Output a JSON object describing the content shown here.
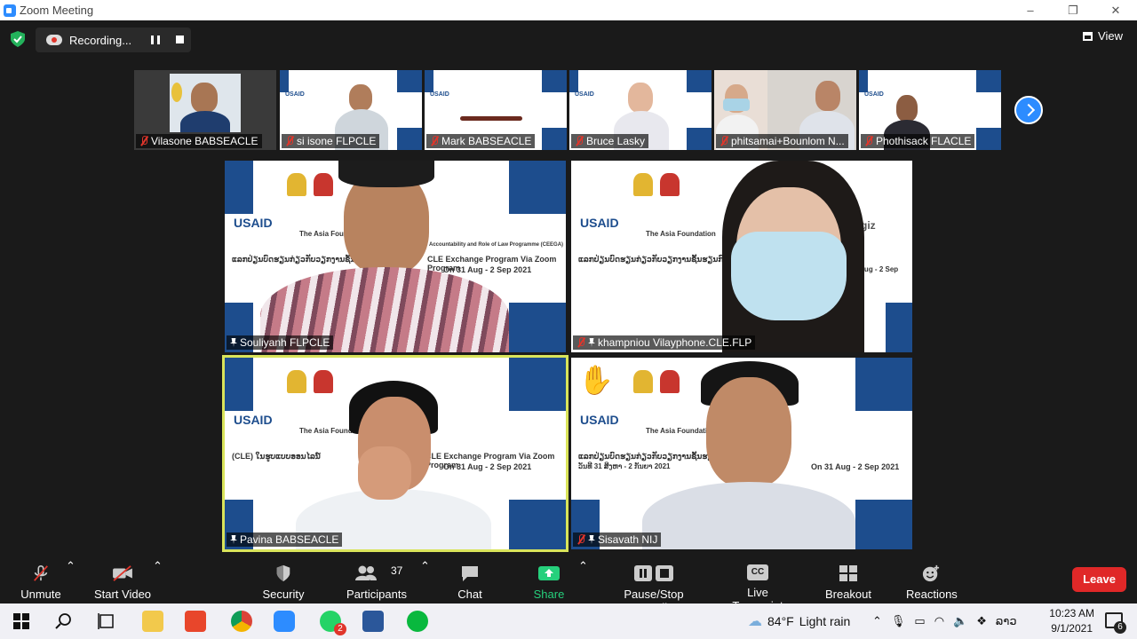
{
  "window": {
    "title": "Zoom Meeting",
    "controls": [
      "–",
      "❐",
      "✕"
    ]
  },
  "top": {
    "recording_label": "Recording...",
    "view_label": "View"
  },
  "strip": [
    {
      "name": "Vilasone BABSEACLE"
    },
    {
      "name": "si isone FLPCLE"
    },
    {
      "name": "Mark BABSEACLE"
    },
    {
      "name": "Bruce Lasky"
    },
    {
      "name": "phitsamai+Bounlom N..."
    },
    {
      "name": "Phothisack FLACLE"
    }
  ],
  "gallery": [
    {
      "name": "Souliyanh FLPCLE",
      "muted": false,
      "pinned": true
    },
    {
      "name": "khampniou Vilayphone.CLE.FLP",
      "muted": true,
      "pinned": true
    },
    {
      "name": "Pavina BABSEACLE",
      "muted": false,
      "pinned": true,
      "active_speaker": true
    },
    {
      "name": "Sisavath NIJ",
      "muted": true,
      "pinned": true,
      "raised_hand": true
    }
  ],
  "banner": {
    "usaid": "USAID",
    "foundation": "The Asia Foundation",
    "giz": "giz",
    "program": "CLE Exchange Program Via Zoom Program",
    "dates": "On 31 Aug - 2 Sep 2021",
    "lao_title": "ແລກປ່ຽນບົດຮຽນກ່ຽວກັບວຽກງານຊັ້ນຮຽນກົດໝາຍ",
    "lao_sub": "(CLE) ໃນຮູບແບບອອນໄລນ໌",
    "lao_date": "ວັນທີ 31 ສິງຫາ - 2 ກັນຍາ 2021",
    "caption": "Accountability and Role of Law Programme (CEEGA)"
  },
  "toolbar": {
    "unmute": "Unmute",
    "start_video": "Start Video",
    "security": "Security",
    "participants": "Participants",
    "participants_count": "37",
    "chat": "Chat",
    "share_screen": "Share Screen",
    "pause_stop_recording": "Pause/Stop Recording",
    "live_transcript": "Live Transcript",
    "breakout_rooms": "Breakout Rooms",
    "reactions": "Reactions",
    "leave": "Leave",
    "cc": "CC"
  },
  "taskbar": {
    "weather_temp": "84°F",
    "weather_desc": "Light rain",
    "lang": "ລາວ",
    "time": "10:23 AM",
    "date": "9/1/2021",
    "notifications": "6",
    "whatsapp_badge": "2"
  },
  "colors": {
    "zoom_blue": "#2d8cff",
    "leave_red": "#e02828",
    "share_green": "#26d07c",
    "active_outline": "#d9e45a",
    "banner_blue": "#1d4d8d"
  }
}
